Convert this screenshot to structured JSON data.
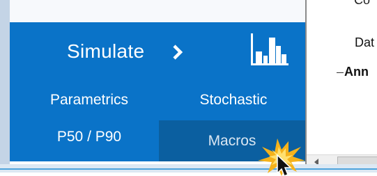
{
  "panel": {
    "simulate_label": "Simulate",
    "buttons": [
      {
        "label": "Parametrics"
      },
      {
        "label": "Stochastic"
      },
      {
        "label": "P50 / P90"
      },
      {
        "label": "Macros"
      }
    ],
    "background": "#0a73c8",
    "active_background": "#0b5fa0"
  },
  "right_pane": {
    "top_text": "Co",
    "date_text": "Dat",
    "ann_text": "Ann"
  },
  "icons": [
    "chevron-right-icon",
    "histogram-icon",
    "scroll-left-arrow-icon",
    "mouse-cursor-icon",
    "click-burst-icon"
  ]
}
